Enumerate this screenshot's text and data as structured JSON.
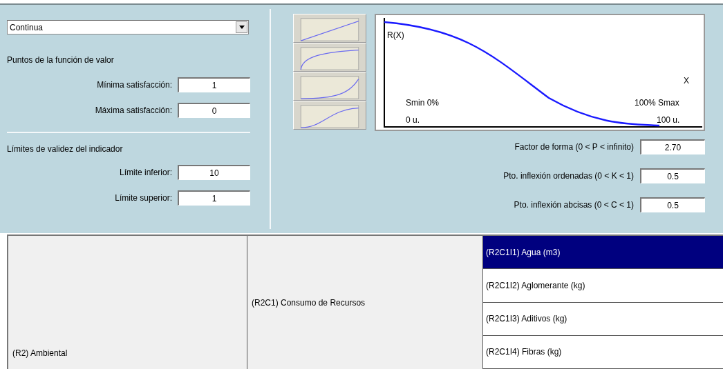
{
  "function_type": {
    "value": "Continua"
  },
  "value_points": {
    "heading": "Puntos de la función de valor",
    "fields": [
      {
        "label": "Mínima satisfacción:",
        "value": "1"
      },
      {
        "label": "Máxima satisfacción:",
        "value": "0"
      }
    ]
  },
  "validity_limits": {
    "heading": "Límites de validez del indicador",
    "fields": [
      {
        "label": "Límite inferior:",
        "value": "10"
      },
      {
        "label": "Límite superior:",
        "value": "1"
      }
    ]
  },
  "shape_presets": [
    {
      "kind": "linear"
    },
    {
      "kind": "concave"
    },
    {
      "kind": "convex"
    },
    {
      "kind": "s-curve"
    }
  ],
  "graph": {
    "y_label": "R(X)",
    "x_label": "X",
    "min_label": "Smin 0%",
    "max_label": "100% Smax",
    "min_units": "0 u.",
    "max_units": "100 u."
  },
  "shape_params": [
    {
      "label": "Factor de forma (0 < P < infinito)",
      "value": "2.70"
    },
    {
      "label": "Pto. inflexión ordenadas (0 < K < 1)",
      "value": "0.5"
    },
    {
      "label": "Pto. inflexión abcisas (0 < C < 1)",
      "value": "0.5"
    }
  ],
  "tree": {
    "requirement": "(R2) Ambiental",
    "criterion": "(R2C1) Consumo de Recursos",
    "indicators": [
      {
        "label": "(R2C1I1) Agua (m3)",
        "selected": true
      },
      {
        "label": "(R2C1I2) Aglomerante (kg)",
        "selected": false
      },
      {
        "label": "(R2C1I3) Aditivos (kg)",
        "selected": false
      },
      {
        "label": "(R2C1I4) Fibras (kg)",
        "selected": false
      }
    ]
  }
}
